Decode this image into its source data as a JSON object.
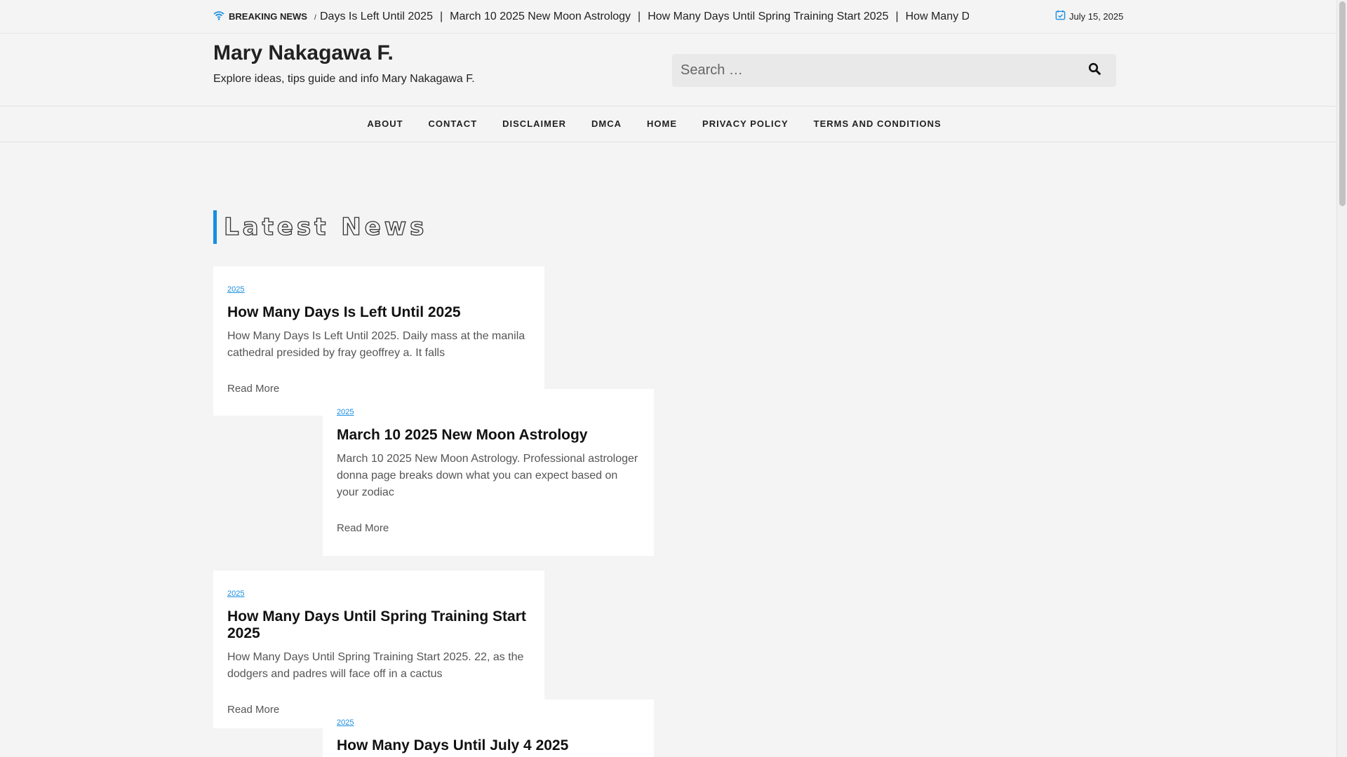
{
  "topbar": {
    "breaking_label": "BREAKING NEWS",
    "ticker": [
      "Days Is Left Until 2025",
      "March 10 2025 New Moon Astrology",
      "How Many Days Until Spring Training Start 2025",
      "How Many Da"
    ],
    "ticker_separator": "|",
    "date": "July 15, 2025"
  },
  "header": {
    "site_title": "Mary Nakagawa F.",
    "tagline": "Explore ideas, tips guide and info Mary Nakagawa F.",
    "search_placeholder": "Search …"
  },
  "nav": {
    "items": [
      "ABOUT",
      "CONTACT",
      "DISCLAIMER",
      "DMCA",
      "HOME",
      "PRIVACY POLICY",
      "TERMS AND CONDITIONS"
    ]
  },
  "main": {
    "section_title": "Latest News",
    "posts": [
      {
        "category": "2025",
        "title": "How Many Days Is Left Until 2025",
        "excerpt": "How Many Days Is Left Until 2025. Daily mass at the manila cathedral presided by fray geoffrey a. It falls",
        "read_more": "Read More"
      },
      {
        "category": "2025",
        "title": "March 10 2025 New Moon Astrology",
        "excerpt": "March 10 2025 New Moon Astrology. Professional astrologer donna page breaks down what you can expect based on your zodiac",
        "read_more": "Read More"
      },
      {
        "category": "2025",
        "title": "How Many Days Until Spring Training Start 2025",
        "excerpt": "How Many Days Until Spring Training Start 2025. 22, as the dodgers and padres will face off in a cactus",
        "read_more": "Read More"
      },
      {
        "category": "2025",
        "title": "How Many Days Until July 4 2025",
        "excerpt": "",
        "read_more": ""
      }
    ]
  },
  "colors": {
    "accent": "#1a8ee1",
    "background": "#f4f4f4",
    "card": "#ffffff"
  },
  "icons": {
    "breaking": "wifi-icon",
    "date": "calendar-check-icon",
    "search": "search-icon"
  }
}
